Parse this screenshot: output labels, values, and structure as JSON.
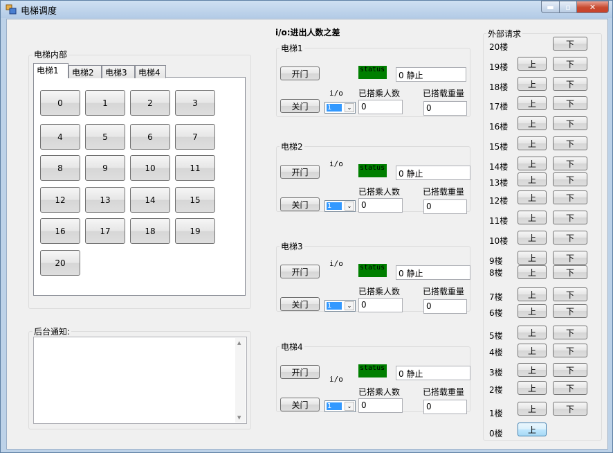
{
  "window": {
    "title": "电梯调度",
    "minimize_glyph": "▬",
    "maximize_glyph": "▫",
    "close_glyph": "✕"
  },
  "header": {
    "io_note": "i/o:进出人数之差"
  },
  "inside": {
    "group_label": "电梯内部",
    "tabs": [
      "电梯1",
      "电梯2",
      "电梯3",
      "电梯4"
    ],
    "floor_buttons": [
      "0",
      "1",
      "2",
      "3",
      "4",
      "5",
      "6",
      "7",
      "8",
      "9",
      "10",
      "11",
      "12",
      "13",
      "14",
      "15",
      "16",
      "17",
      "18",
      "19",
      "20"
    ]
  },
  "notice": {
    "label": "后台通知:",
    "up_glyph": "▲",
    "down_glyph": "▼"
  },
  "common": {
    "open_label": "开门",
    "close_label": "关门",
    "status_label": "status",
    "io_label": "i/o",
    "passengers_label": "已搭乘人数",
    "weight_label": "已搭载重量",
    "io_value": "1",
    "spin_glyph": "⌄"
  },
  "elevators": [
    {
      "title": "电梯1",
      "status_text": "0   静止",
      "passengers": "0",
      "weight": "0"
    },
    {
      "title": "电梯2",
      "status_text": "0   静止",
      "passengers": "0",
      "weight": "0"
    },
    {
      "title": "电梯3",
      "status_text": "0   静止",
      "passengers": "0",
      "weight": "0"
    },
    {
      "title": "电梯4",
      "status_text": "0   静止",
      "passengers": "0",
      "weight": "0"
    }
  ],
  "outside": {
    "group_label": "外部请求",
    "up_label": "上",
    "down_label": "下",
    "floors": [
      "20楼",
      "19楼",
      "18楼",
      "17楼",
      "16楼",
      "15楼",
      "14楼",
      "13楼",
      "12楼",
      "11楼",
      "10楼",
      "9楼",
      "8楼",
      "7楼",
      "6楼",
      "5楼",
      "4楼",
      "3楼",
      "2楼",
      "1楼",
      "0楼"
    ]
  }
}
